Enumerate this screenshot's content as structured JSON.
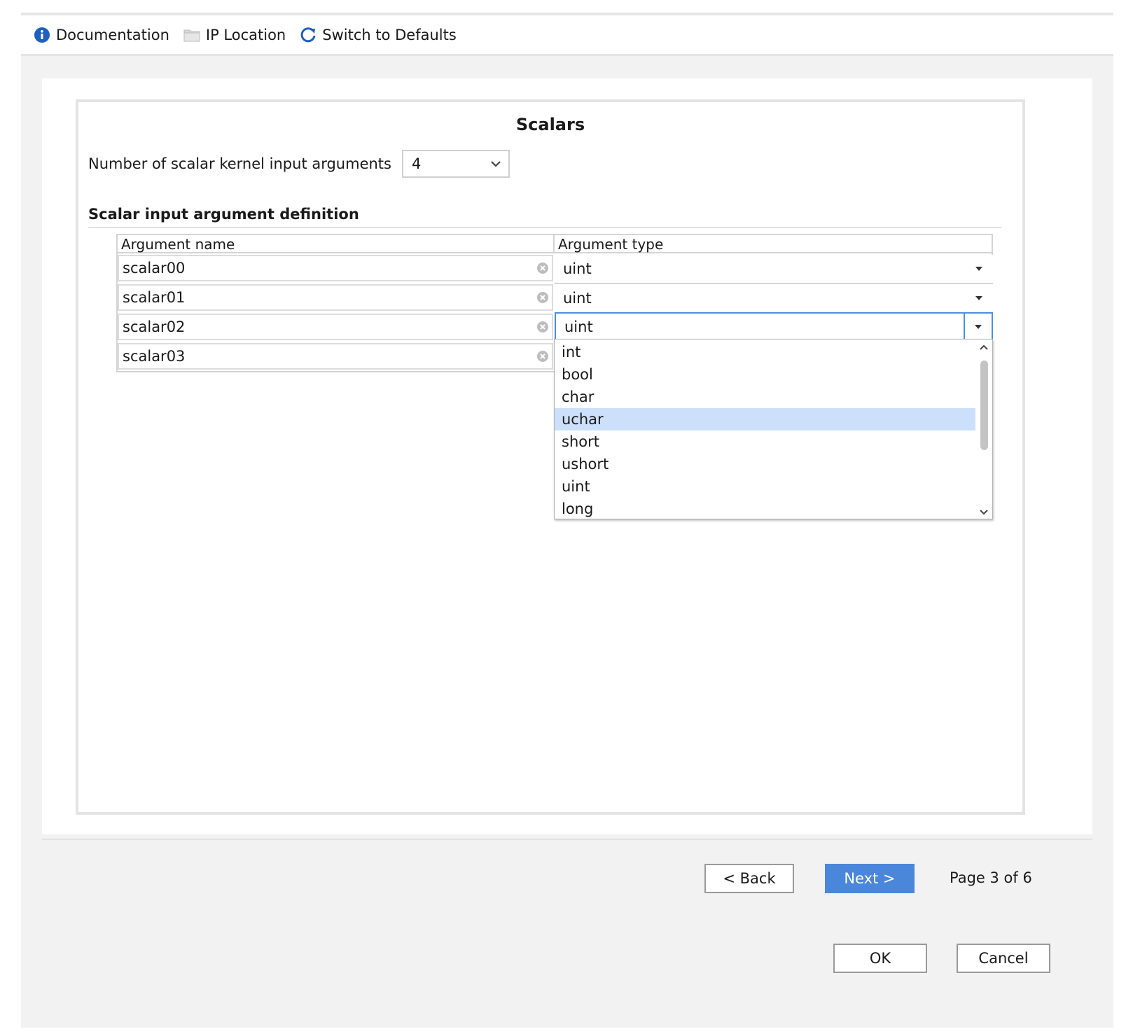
{
  "toolbar": {
    "documentation_label": "Documentation",
    "ip_location_label": "IP Location",
    "switch_defaults_label": "Switch to Defaults"
  },
  "panel": {
    "title": "Scalars",
    "num_args_label": "Number of scalar kernel input arguments",
    "num_args_value": "4",
    "section_title": "Scalar input argument definition"
  },
  "table": {
    "headers": [
      "Argument name",
      "Argument type"
    ],
    "rows": [
      {
        "name": "scalar00",
        "type": "uint"
      },
      {
        "name": "scalar01",
        "type": "uint"
      },
      {
        "name": "scalar02",
        "type": "uint"
      },
      {
        "name": "scalar03",
        "type": ""
      }
    ]
  },
  "dropdown": {
    "options": [
      "int",
      "bool",
      "char",
      "uchar",
      "short",
      "ushort",
      "uint",
      "long"
    ],
    "highlighted": "uchar"
  },
  "footer": {
    "back_label": "< Back",
    "next_label": "Next >",
    "page_info": "Page 3 of 6",
    "ok_label": "OK",
    "cancel_label": "Cancel"
  },
  "colors": {
    "accent": "#4a86d9",
    "highlight": "#cce0fb",
    "focus_border": "#4a90d9"
  }
}
